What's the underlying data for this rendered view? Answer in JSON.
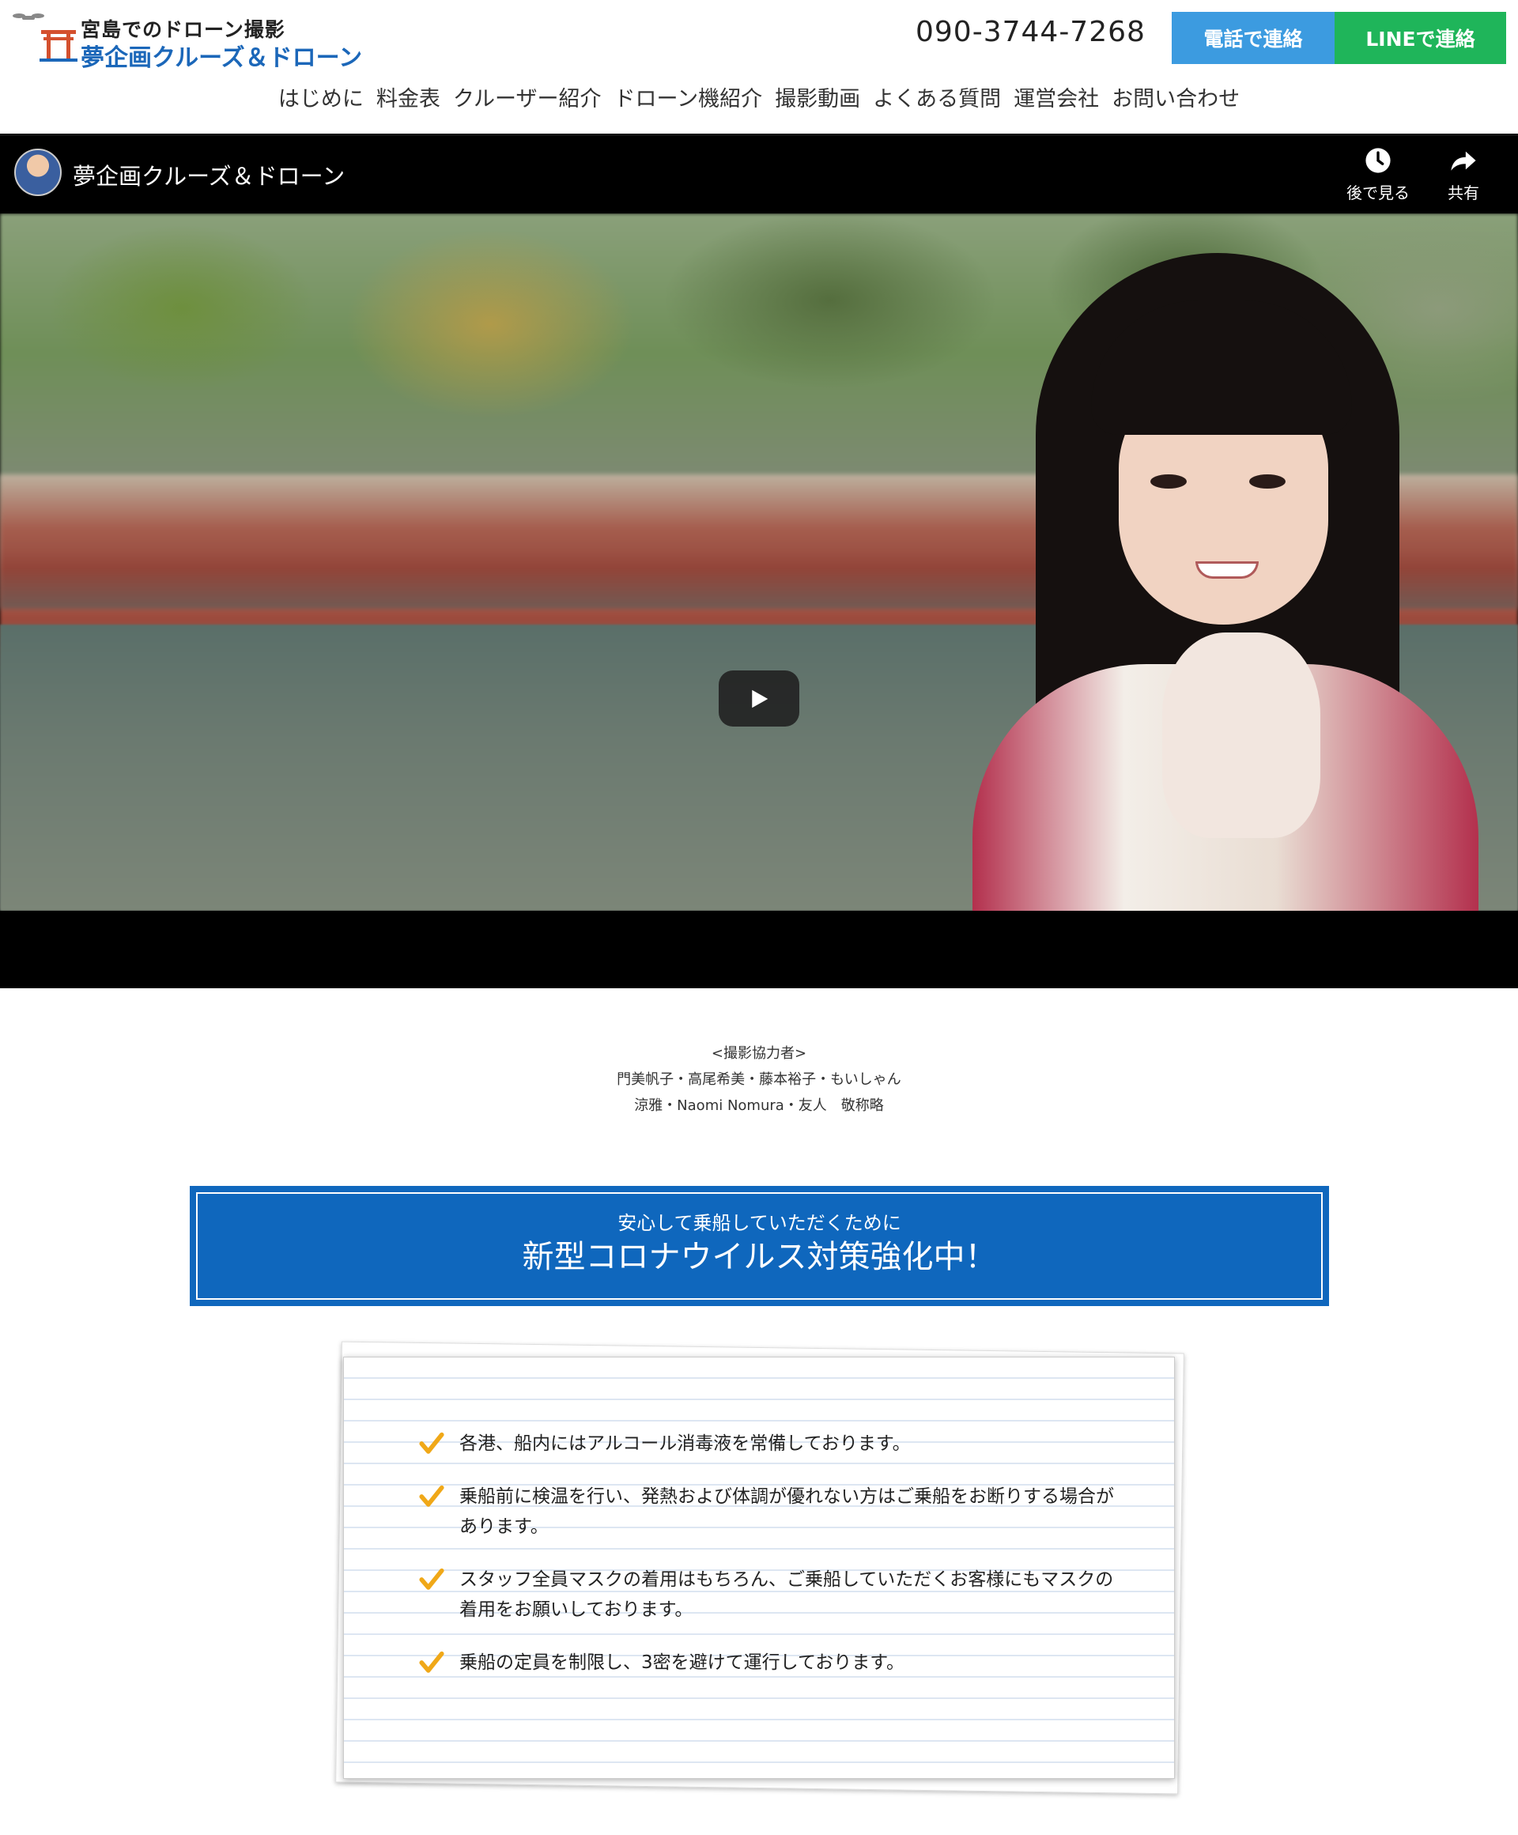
{
  "header": {
    "logo_line1": "宮島でのドローン撮影",
    "logo_line2": "夢企画クルーズ＆ドローン",
    "phone": "090-3744-7268",
    "btn_tel": "電話で連絡",
    "btn_line": "LINEで連絡",
    "colors": {
      "tel_button": "#3c9be0",
      "line_button": "#1fb55a",
      "brand_blue": "#1b67b9"
    }
  },
  "nav": [
    "はじめに",
    "料金表",
    "クルーザー紹介",
    "ドローン機紹介",
    "撮影動画",
    "よくある質問",
    "運営会社",
    "お問い合わせ"
  ],
  "video": {
    "channel_title": "夢企画クルーズ＆ドローン",
    "watch_later": "後で見る",
    "share": "共有",
    "icons": [
      "clock-icon",
      "share-arrow-icon",
      "play-icon"
    ]
  },
  "credits": {
    "heading": "<撮影協力者>",
    "line1": "門美帆子・高尾希美・藤本裕子・もいしゃん",
    "line2": "涼雅・Naomi Nomura・友人　敬称略"
  },
  "covid": {
    "subtitle": "安心して乗船していただくために",
    "title": "新型コロナウイルス対策強化中！",
    "color": "#0f67bd"
  },
  "measures": [
    "各港、船内にはアルコール消毒液を常備しております。",
    "乗船前に検温を行い、発熱および体調が優れない方はご乗船をお断りする場合があります。",
    "スタッフ全員マスクの着用はもちろん、ご乗船していただくお客様にもマスクの着用をお願いしております。",
    "乗船の定員を制限し、3密を避けて運行しております。"
  ],
  "check_color": "#f0a818"
}
